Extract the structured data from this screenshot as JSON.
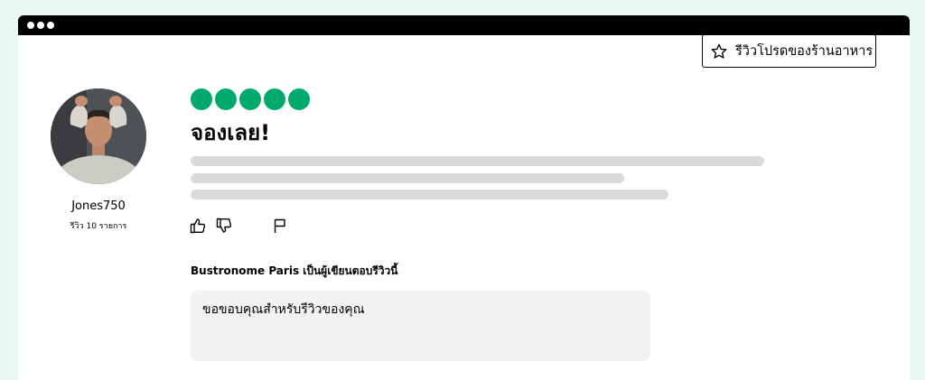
{
  "header": {
    "favorite_label": "รีวิวโปรดของร้านอาหาร",
    "favorite_icon": "star-outline-icon"
  },
  "reviewer": {
    "username": "Jones750",
    "review_count": "รีวิว 10 รายการ"
  },
  "review": {
    "rating": 5,
    "rating_max": 5,
    "rating_color": "#00aa6c",
    "title": "จองเลย!",
    "actions": {
      "helpful_icon": "thumbs-up-icon",
      "not_helpful_icon": "thumbs-down-icon",
      "report_icon": "flag-icon"
    }
  },
  "response": {
    "title": "Bustronome Paris เป็นผู้เขียนตอบรีวิวนี้",
    "text": "ขอขอบคุณสำหรับรีวิวของคุณ"
  }
}
